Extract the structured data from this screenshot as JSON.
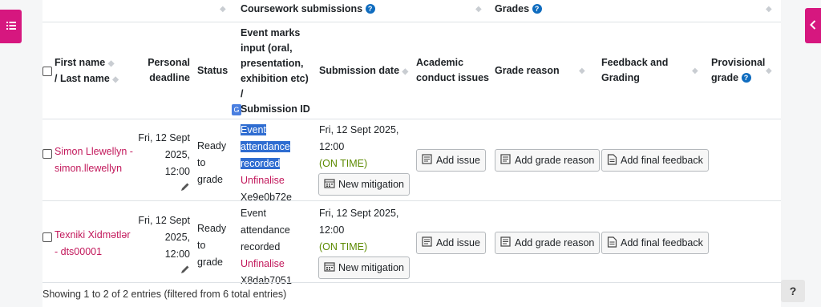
{
  "group_header": {
    "coursework": "Coursework submissions",
    "grades": "Grades"
  },
  "columns": {
    "name_line1": "First name",
    "name_line2": "/ Last name",
    "personal_line1": "Personal",
    "personal_line2": "deadline",
    "status": "Status",
    "event_lines": [
      "Event marks",
      "input (oral,",
      "presentation,",
      "exhibition etc)",
      "/",
      "Submission ID"
    ],
    "submission_date": "Submission date",
    "academic_line1": "Academic",
    "academic_line2": "conduct issues",
    "grade_reason": "Grade reason",
    "feedback_line1": "Feedback and",
    "feedback_line2": "Grading",
    "provisional_line1": "Provisional",
    "provisional_line2": "grade"
  },
  "rows": [
    {
      "name_line1": "Simon Llewellyn -",
      "name_line2": "simon.llewellyn",
      "deadline_line1": "Fri, 12 Sept",
      "deadline_line2": "2025,",
      "deadline_line3": "12:00",
      "status_lines": [
        "Ready",
        "to",
        "grade"
      ],
      "event_lines": [
        "Event",
        "attendance",
        "recorded"
      ],
      "unfinalise": "Unfinalise",
      "submission_id": "Xe9e0b72e",
      "date_line1": "Fri, 12 Sept 2025,",
      "date_line2": "12:00",
      "timing": "(ON TIME)",
      "mitigation": "New mitigation",
      "add_issue": "Add issue",
      "add_grade_reason": "Add grade reason",
      "add_final_feedback": "Add final feedback"
    },
    {
      "name_line1": "Texniki Xidmətlər",
      "name_line2": "- dts00001",
      "deadline_line1": "Fri, 12 Sept",
      "deadline_line2": "2025,",
      "deadline_line3": "12:00",
      "status_lines": [
        "Ready",
        "to",
        "grade"
      ],
      "event_lines": [
        "Event",
        "attendance",
        "recorded"
      ],
      "unfinalise": "Unfinalise",
      "submission_id": "X8dab7051",
      "date_line1": "Fri, 12 Sept 2025,",
      "date_line2": "12:00",
      "timing": "(ON TIME)",
      "mitigation": "New mitigation",
      "add_issue": "Add issue",
      "add_grade_reason": "Add grade reason",
      "add_final_feedback": "Add final feedback"
    }
  ],
  "footer": "Showing 1 to 2 of 2 entries (filtered from 6 total entries)",
  "help": "?",
  "colors": {
    "accent": "#d6177f",
    "link": "#c2185b",
    "ontime": "#5c8a00",
    "info": "#0f6cbf"
  }
}
